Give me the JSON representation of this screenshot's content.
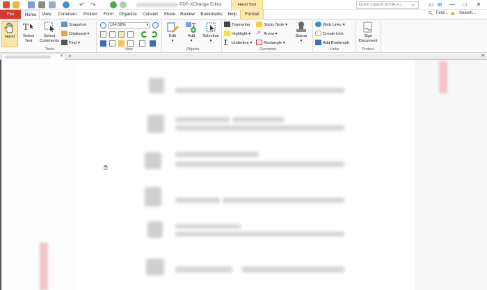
{
  "window": {
    "title": "- PDF-XChange Editor",
    "context_tab_title": "Hand Tool",
    "quick_launch_placeholder": "Quick Launch (CTRL+.)"
  },
  "tabs": [
    "File",
    "Home",
    "View",
    "Comment",
    "Protect",
    "Form",
    "Organize",
    "Convert",
    "Share",
    "Review",
    "Bookmarks",
    "Help",
    "Format"
  ],
  "active_tab": "Home",
  "header_right": {
    "find": "Find...",
    "search": "Search..."
  },
  "ribbon": {
    "tools": {
      "hand": "Hand",
      "select_text": "Select Text",
      "select_comments": "Select Comments",
      "snapshot": "Snapshot",
      "clipboard": "Clipboard",
      "find": "Find",
      "label": "Tools"
    },
    "view": {
      "zoom": "164.58%",
      "label": "View"
    },
    "objects": {
      "edit": "Edit",
      "add": "Add",
      "selection": "Selection",
      "label": "Objects"
    },
    "comment": {
      "typewriter": "Typewriter",
      "sticky_note": "Sticky Note",
      "highlight": "Highlight",
      "arrow": "Arrow",
      "underline": "Underline",
      "rectangle": "Rectangle",
      "stamp": "Stamp",
      "label": "Comment"
    },
    "links": {
      "web_links": "Web Links",
      "create_link": "Create Link",
      "add_bookmark": "Add Bookmark",
      "label": "Links"
    },
    "protect": {
      "sign_document": "Sign Document",
      "label": "Protect"
    }
  },
  "colors": {
    "file_tab": "#d13b2e",
    "context_tab": "#fbe9b0",
    "active_tool": "#fbe6a8"
  }
}
